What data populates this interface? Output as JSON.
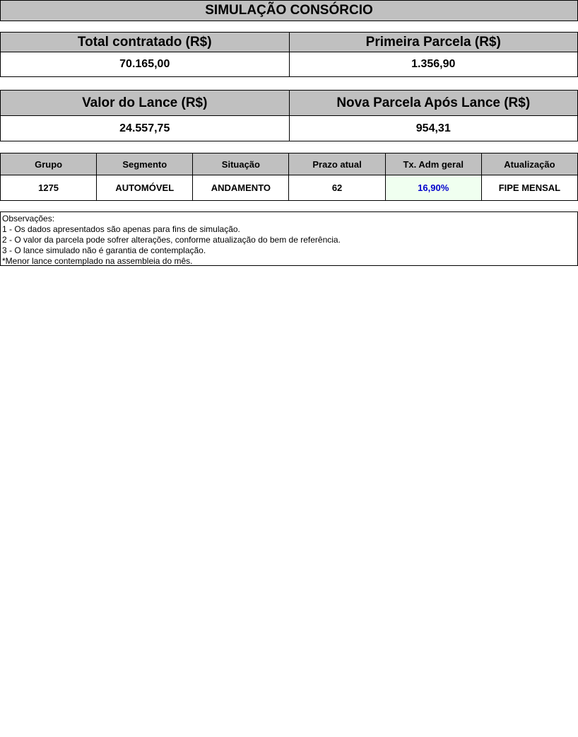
{
  "title": "SIMULAÇÃO CONSÓRCIO",
  "summary": {
    "total_label": "Total contratado (R$)",
    "total_value": "70.165,00",
    "primeira_label": "Primeira Parcela (R$)",
    "primeira_value": "1.356,90"
  },
  "lance": {
    "valor_label": "Valor do Lance (R$)",
    "valor_value": "24.557,75",
    "nova_label": "Nova Parcela Após Lance (R$)",
    "nova_value": "954,31"
  },
  "info": {
    "headers": [
      "Grupo",
      "Segmento",
      "Situação",
      "Prazo atual",
      "Tx. Adm geral",
      "Atualização"
    ],
    "values": [
      "1275",
      "AUTOMÓVEL",
      "ANDAMENTO",
      "62",
      "16,90%",
      "FIPE MENSAL"
    ]
  },
  "observations": {
    "heading": "Observações:",
    "lines": [
      "1 - Os dados apresentados são apenas para fins de simulação.",
      "2 - O valor da parcela pode sofrer alterações, conforme atualização do bem de referência.",
      "3 - O lance simulado não é garantia de contemplação.",
      "*Menor lance contemplado na assembleia do mês."
    ]
  },
  "colors": {
    "header_bg": "#c0c0c0",
    "highlight_bg": "#f0fff0",
    "highlight_text": "#0000cc"
  }
}
